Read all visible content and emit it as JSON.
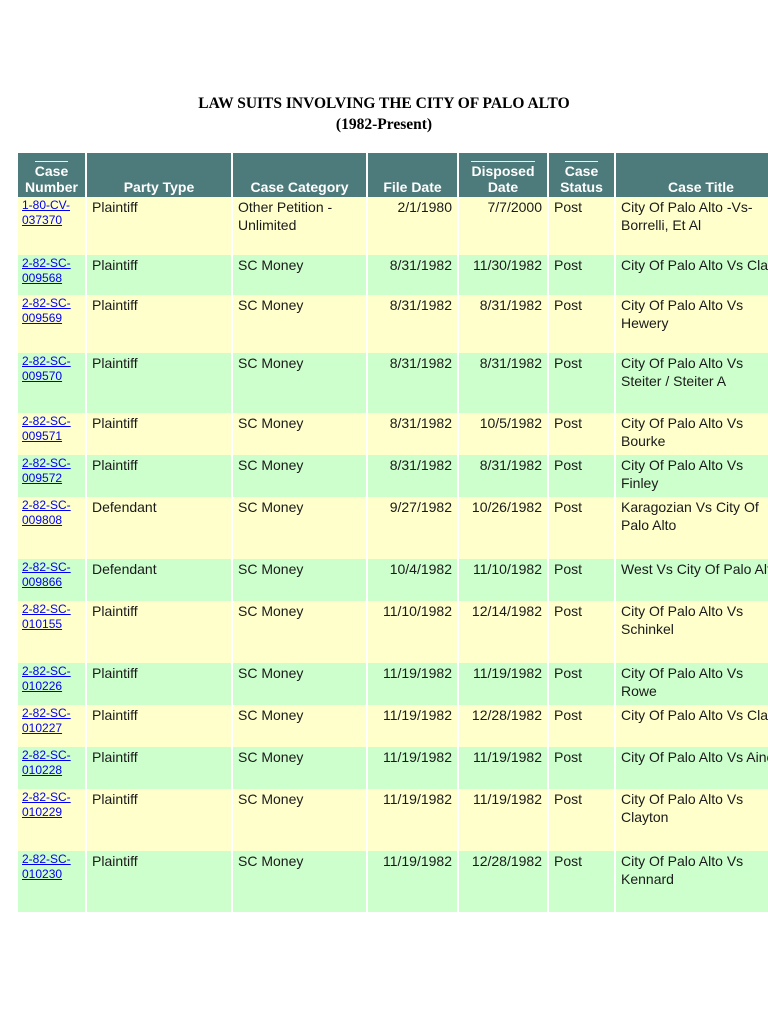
{
  "title": "LAW SUITS INVOLVING THE CITY OF PALO ALTO",
  "subtitle": "(1982-Present)",
  "columns": {
    "case_number": [
      "Case",
      "Number"
    ],
    "party_type": "Party Type",
    "case_category": "Case Category",
    "file_date": "File Date",
    "disposed_date": [
      "Disposed",
      "Date"
    ],
    "case_status": [
      "Case",
      "Status"
    ],
    "case_title": "Case Title"
  },
  "rows": [
    {
      "case": [
        "1-80-CV-",
        "037370"
      ],
      "party": "Plaintiff",
      "category": "Other Petition - Unlimited",
      "file": "2/1/1980",
      "disposed": "7/7/2000",
      "status": "Post",
      "title": "City Of Palo Alto -Vs- Borrelli, Et Al",
      "color": "yellow",
      "h": 58
    },
    {
      "case": [
        "2-82-SC-",
        "009568"
      ],
      "party": "Plaintiff",
      "category": "SC Money",
      "file": "8/31/1982",
      "disposed": "11/30/1982",
      "status": "Post",
      "title": "City Of Palo Alto Vs Clark",
      "color": "green",
      "h": 40
    },
    {
      "case": [
        "2-82-SC-",
        "009569"
      ],
      "party": "Plaintiff",
      "category": "SC Money",
      "file": "8/31/1982",
      "disposed": "8/31/1982",
      "status": "Post",
      "title": "City Of Palo Alto Vs Hewery",
      "color": "yellow",
      "h": 58
    },
    {
      "case": [
        "2-82-SC-",
        "009570"
      ],
      "party": "Plaintiff",
      "category": "SC Money",
      "file": "8/31/1982",
      "disposed": "8/31/1982",
      "status": "Post",
      "title": "City Of Palo Alto Vs Steiter / Steiter A",
      "color": "green",
      "h": 60
    },
    {
      "case": [
        "2-82-SC-",
        "009571"
      ],
      "party": "Plaintiff",
      "category": "SC Money",
      "file": "8/31/1982",
      "disposed": "10/5/1982",
      "status": "Post",
      "title": "City Of Palo Alto Vs Bourke",
      "color": "yellow",
      "h": 42
    },
    {
      "case": [
        "2-82-SC-",
        "009572"
      ],
      "party": "Plaintiff",
      "category": "SC Money",
      "file": "8/31/1982",
      "disposed": "8/31/1982",
      "status": "Post",
      "title": "City Of Palo Alto Vs Finley",
      "color": "green",
      "h": 42
    },
    {
      "case": [
        "2-82-SC-",
        "009808"
      ],
      "party": "Defendant",
      "category": "SC Money",
      "file": "9/27/1982",
      "disposed": "10/26/1982",
      "status": "Post",
      "title": "Karagozian Vs City Of Palo Alto",
      "color": "yellow",
      "h": 62
    },
    {
      "case": [
        "2-82-SC-",
        "009866"
      ],
      "party": "Defendant",
      "category": "SC Money",
      "file": "10/4/1982",
      "disposed": "11/10/1982",
      "status": "Post",
      "title": "West Vs City Of Palo Alto",
      "color": "green",
      "h": 42
    },
    {
      "case": [
        "2-82-SC-",
        "010155"
      ],
      "party": "Plaintiff",
      "category": "SC Money",
      "file": "11/10/1982",
      "disposed": "12/14/1982",
      "status": "Post",
      "title": "City Of Palo Alto Vs Schinkel",
      "color": "yellow",
      "h": 62
    },
    {
      "case": [
        "2-82-SC-",
        "010226"
      ],
      "party": "Plaintiff",
      "category": "SC Money",
      "file": "11/19/1982",
      "disposed": "11/19/1982",
      "status": "Post",
      "title": "City Of Palo Alto Vs Rowe",
      "color": "green",
      "h": 42
    },
    {
      "case": [
        "2-82-SC-",
        "010227"
      ],
      "party": "Plaintiff",
      "category": "SC Money",
      "file": "11/19/1982",
      "disposed": "12/28/1982",
      "status": "Post",
      "title": "City Of Palo Alto Vs Clark",
      "color": "yellow",
      "h": 42
    },
    {
      "case": [
        "2-82-SC-",
        "010228"
      ],
      "party": "Plaintiff",
      "category": "SC Money",
      "file": "11/19/1982",
      "disposed": "11/19/1982",
      "status": "Post",
      "title": "City Of Palo Alto Vs Aine",
      "color": "green",
      "h": 42
    },
    {
      "case": [
        "2-82-SC-",
        "010229"
      ],
      "party": "Plaintiff",
      "category": "SC Money",
      "file": "11/19/1982",
      "disposed": "11/19/1982",
      "status": "Post",
      "title": "City Of Palo Alto Vs Clayton",
      "color": "yellow",
      "h": 62
    },
    {
      "case": [
        "2-82-SC-",
        "010230"
      ],
      "party": "Plaintiff",
      "category": "SC Money",
      "file": "11/19/1982",
      "disposed": "12/28/1982",
      "status": "Post",
      "title": "City Of Palo Alto Vs Kennard",
      "color": "green",
      "h": 61
    }
  ]
}
